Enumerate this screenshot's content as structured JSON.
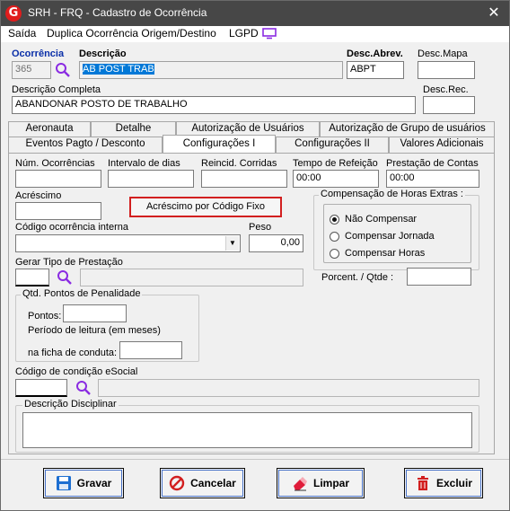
{
  "window": {
    "title": "SRH - FRQ - Cadastro de Ocorrência",
    "close_glyph": "✕"
  },
  "menu": {
    "items": [
      "Saída",
      "Duplica Ocorrência Origem/Destino",
      "LGPD"
    ]
  },
  "header": {
    "ocorrencia_label": "Ocorrência",
    "ocorrencia_value": "365",
    "descricao_label": "Descrição",
    "descricao_value": "AB POST TRAB",
    "desc_abrev_label": "Desc.Abrev.",
    "desc_abrev_value": "ABPT",
    "desc_mapa_label": "Desc.Mapa",
    "desc_mapa_value": "",
    "desc_completa_label": "Descrição Completa",
    "desc_completa_value": "ABANDONAR POSTO DE TRABALHO",
    "desc_rec_label": "Desc.Rec.",
    "desc_rec_value": ""
  },
  "tabs": {
    "row1": [
      "Aeronauta",
      "Detalhe",
      "Autorização de Usuários",
      "Autorização de Grupo de usuários"
    ],
    "row2": [
      "Eventos Pagto / Desconto",
      "Configurações I",
      "Configurações II",
      "Valores Adicionais"
    ],
    "active": "Configurações I"
  },
  "config": {
    "num_ocorrencias_label": "Núm. Ocorrências",
    "num_ocorrencias_value": "",
    "intervalo_label": "Intervalo de dias",
    "intervalo_value": "",
    "reincid_label": "Reincid. Corridas",
    "reincid_value": "",
    "tempo_refeicao_label": "Tempo de Refeição",
    "tempo_refeicao_value": "00:00",
    "prestacao_contas_label": "Prestação de Contas",
    "prestacao_contas_value": "00:00",
    "acrescimo_label": "Acréscimo",
    "acrescimo_value": "",
    "acrescimo_fixo_button": "Acréscimo por Código Fixo",
    "compensacao_title": "Compensação de Horas Extras :",
    "compensacao_options": [
      "Não Compensar",
      "Compensar Jornada",
      "Compensar Horas"
    ],
    "compensacao_selected": "Não Compensar",
    "porcent_label": "Porcent. / Qtde :",
    "porcent_value": "",
    "codigo_interna_label": "Código ocorrência interna",
    "codigo_interna_value": "",
    "peso_label": "Peso",
    "peso_value": "0,00",
    "gerar_tipo_label": "Gerar Tipo de Prestação",
    "gerar_tipo_value": "",
    "penalidade_title": "Qtd. Pontos de Penalidade",
    "pontos_label": "Pontos:",
    "pontos_value": "",
    "periodo_label": "Período de leitura (em meses)",
    "ficha_label": "na ficha de conduta:",
    "ficha_value": "",
    "esocial_label": "Código de condição eSocial",
    "esocial_value": "",
    "disciplinar_title": "Descrição Disciplinar",
    "disciplinar_value": ""
  },
  "actions": [
    "Gravar",
    "Cancelar",
    "Limpar",
    "Excluir"
  ],
  "icons": {
    "app": "G",
    "search": "magnifier-icon",
    "lgpd": "monitor-icon",
    "gravar": "floppy-disk-icon",
    "cancelar": "no-entry-icon",
    "limpar": "eraser-icon",
    "excluir": "trash-icon"
  },
  "colors": {
    "titlebar": "#474747",
    "accent_red": "#d21f1f",
    "selection": "#0078d7",
    "label_blue": "#0a2fa8"
  }
}
